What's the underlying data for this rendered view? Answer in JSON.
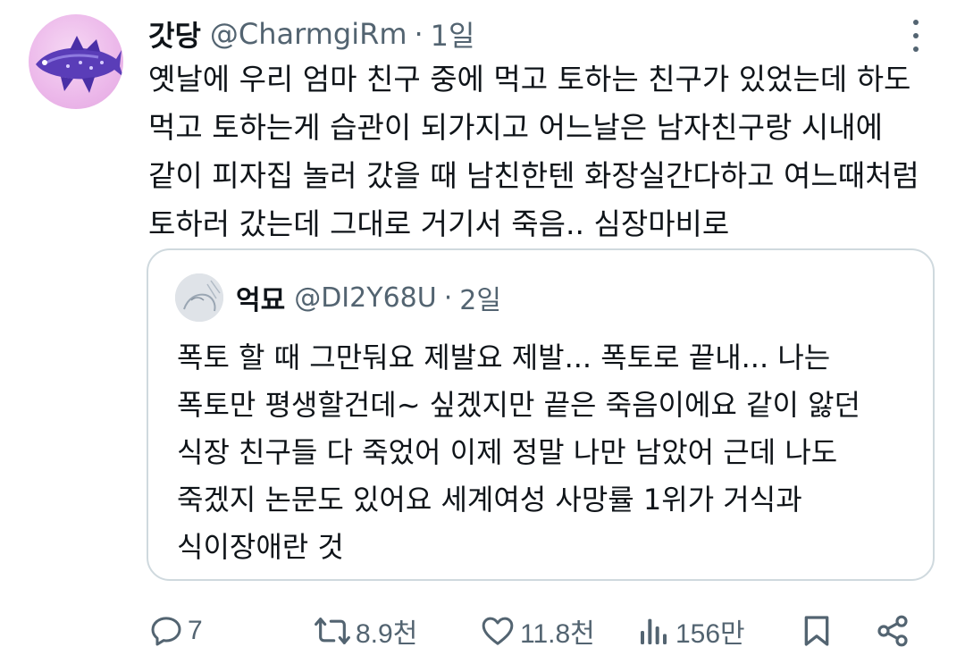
{
  "tweet": {
    "display_name": "갓당",
    "handle": "@CharmgiRm",
    "separator": "·",
    "time": "1일",
    "text_lines": [
      "옛날에 우리 엄마 친구 중에 먹고 토하는 친구가 있었는데 하도",
      "먹고 토하는게 습관이 되가지고 어느날은 남자친구랑 시내에",
      "같이 피자집 놀러 갔을 때 남친한텐 화장실간다하고 여느때처럼",
      "토하러 갔는데 그대로 거기서 죽음.. 심장마비로"
    ]
  },
  "quote": {
    "display_name": "억묘",
    "handle": "@DI2Y68U",
    "separator": "·",
    "time": "2일",
    "text_lines": [
      "폭토 할 때 그만둬요 제발요 제발... 폭토로 끝내... 나는",
      "폭토만 평생할건데~ 싶겠지만 끝은 죽음이에요 같이 앓던",
      "식장 친구들 다 죽었어 이제 정말 나만 남았어 근데 나도",
      "죽겠지 논문도 있어요 세계여성 사망률 1위가 거식과",
      "식이장애란 것"
    ]
  },
  "actions": {
    "replies": "7",
    "reposts": "8.9천",
    "likes": "11.8천",
    "views": "156만"
  },
  "icons": {
    "reply": "reply-icon",
    "repost": "repost-icon",
    "like": "like-icon",
    "views": "views-icon",
    "bookmark": "bookmark-icon",
    "share": "share-icon",
    "more": "more-options-icon"
  },
  "colors": {
    "text_primary": "#0f1419",
    "text_secondary": "#536471",
    "border": "#cfd9de",
    "avatar_bg": "#ecb8ea"
  }
}
